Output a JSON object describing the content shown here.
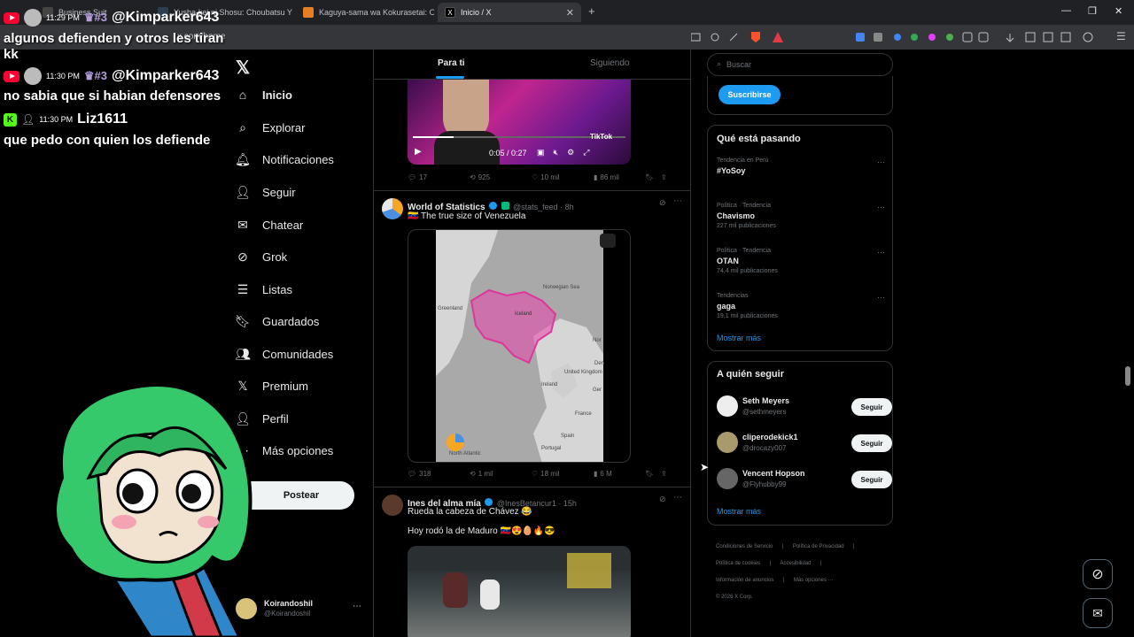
{
  "browser": {
    "tabs": [
      {
        "label": "Business Suit",
        "active": false
      },
      {
        "label": "Yusha-kei ni Shosu: Choubatsu Yuu",
        "active": false
      },
      {
        "label": "Kaguya-sama wa Kokurasetai: Otona",
        "active": false
      },
      {
        "label": "Inicio / X",
        "active": true
      }
    ],
    "new_tab": "+",
    "address": "x.com/home",
    "win_min": "—",
    "win_max": "❐",
    "win_close": "✕"
  },
  "chat": {
    "messages": [
      {
        "time": "11:29 PM",
        "rank": "#3",
        "user": "@Kimparker643",
        "text": "algunos defienden y otros les tiran kk"
      },
      {
        "time": "11:30 PM",
        "rank": "#3",
        "user": "@Kimparker643",
        "text": "no sabia que si habian defensores"
      },
      {
        "time": "11:30 PM",
        "rank": "",
        "user": "Liz1611",
        "text": "que pedo con quien los defiende"
      }
    ]
  },
  "nav": {
    "items": [
      {
        "label": "Inicio",
        "icon": "home-icon",
        "glyph": "⌂"
      },
      {
        "label": "Explorar",
        "icon": "search-icon",
        "glyph": "⌕"
      },
      {
        "label": "Notificaciones",
        "icon": "bell-icon",
        "glyph": "🔔︎"
      },
      {
        "label": "Seguir",
        "icon": "add-person-icon",
        "glyph": "👤︎"
      },
      {
        "label": "Chatear",
        "icon": "mail-icon",
        "glyph": "✉"
      },
      {
        "label": "Grok",
        "icon": "grok-icon",
        "glyph": "⊘"
      },
      {
        "label": "Listas",
        "icon": "list-icon",
        "glyph": "☰"
      },
      {
        "label": "Guardados",
        "icon": "bookmark-icon",
        "glyph": "🔖︎"
      },
      {
        "label": "Comunidades",
        "icon": "people-icon",
        "glyph": "👥︎"
      },
      {
        "label": "Premium",
        "icon": "x-logo-icon",
        "glyph": "𝕏"
      },
      {
        "label": "Perfil",
        "icon": "profile-icon",
        "glyph": "👤︎"
      },
      {
        "label": "Más opciones",
        "icon": "more-icon",
        "glyph": "⋯"
      }
    ],
    "post_label": "Postear",
    "account_name": "Koirandoshil",
    "account_handle": "@Koirandoshil"
  },
  "feed": {
    "tab_for_you": "Para ti",
    "tab_following": "Siguiendo",
    "video": {
      "time": "0:05 / 0:27",
      "tiktok": "TikTok"
    },
    "tweet0": {
      "replies": "17",
      "reposts": "925",
      "likes": "10 mil",
      "views": "86 mil"
    },
    "tweet1": {
      "name": "World of Statistics",
      "handle": "@stats_feed · 8h",
      "text": "🇻🇪 The true size of Venezuela",
      "map_labels": [
        "Greenland",
        "Iceland",
        "Norwegian Sea",
        "United Kingdom",
        "Ireland",
        "France",
        "Spain",
        "Portugal",
        "North Atlantic",
        "Nor",
        "Den",
        "Ger"
      ],
      "replies": "318",
      "reposts": "1 mil",
      "likes": "18 mil",
      "views": "6 M"
    },
    "tweet2": {
      "name": "Ines del alma mía",
      "handle": "@InesBetancur1 · 15h",
      "text": "Rueda la cabeza de Chávez 😂",
      "text2": "Hoy rodó la de Maduro 🇻🇪😍🥚🔥😎"
    }
  },
  "right": {
    "search_placeholder": "Buscar",
    "subscribe_label": "Suscribirse",
    "trends_title": "Qué está pasando",
    "trends": [
      {
        "meta": "Tendencia en Perú",
        "name": "#YoSoy",
        "count": ""
      },
      {
        "meta": "Política · Tendencia",
        "name": "Chavismo",
        "count": "227 mil publicaciones"
      },
      {
        "meta": "Política · Tendencia",
        "name": "OTAN",
        "count": "74,4 mil publicaciones"
      },
      {
        "meta": "Tendencias",
        "name": "gaga",
        "count": "19,1 mil publicaciones"
      }
    ],
    "show_more": "Mostrar más",
    "follow_title": "A quién seguir",
    "follow": [
      {
        "name": "Seth Meyers",
        "handle": "@sethmeyers",
        "button": "Seguir"
      },
      {
        "name": "cliperodekick1",
        "handle": "@drocazy007",
        "button": "Seguir"
      },
      {
        "name": "Vencent Hopson",
        "handle": "@Flyhubby99",
        "button": "Seguir"
      }
    ],
    "show_more2": "Mostrar más",
    "footer": [
      "Condiciones de Servicio",
      "Política de Privacidad",
      "Política de cookies",
      "Accesibilidad",
      "Información de anuncios",
      "Más opciones ···",
      "© 2026 X Corp."
    ]
  },
  "colors": {
    "accent": "#1d9bf0",
    "bg": "#000000",
    "border": "#2f3336"
  }
}
